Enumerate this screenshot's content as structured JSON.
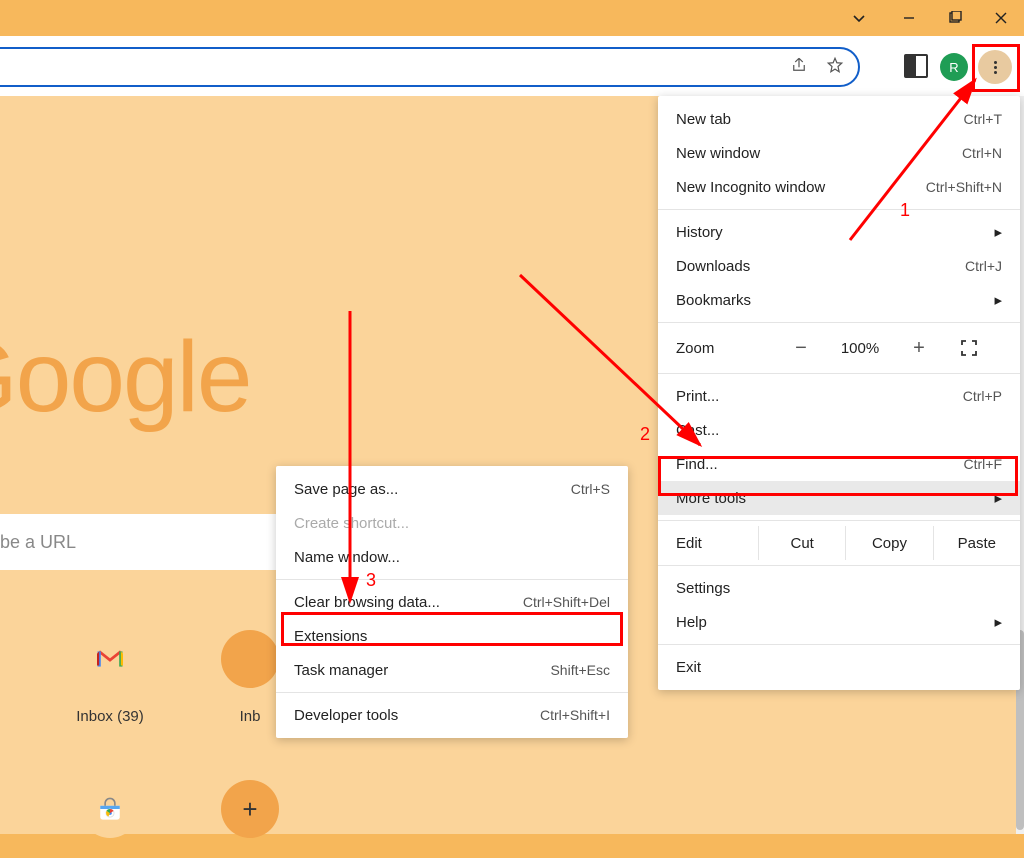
{
  "profile_initial": "R",
  "omnibox_placeholder": "be a URL",
  "google_logo": "Google",
  "shortcuts": [
    {
      "label": ""
    },
    {
      "label": "Inbox (39)"
    },
    {
      "label": "Inb"
    }
  ],
  "main_menu": {
    "new_tab": {
      "label": "New tab",
      "shortcut": "Ctrl+T"
    },
    "new_window": {
      "label": "New window",
      "shortcut": "Ctrl+N"
    },
    "new_incognito": {
      "label": "New Incognito window",
      "shortcut": "Ctrl+Shift+N"
    },
    "history": {
      "label": "History"
    },
    "downloads": {
      "label": "Downloads",
      "shortcut": "Ctrl+J"
    },
    "bookmarks": {
      "label": "Bookmarks"
    },
    "zoom": {
      "label": "Zoom",
      "minus": "−",
      "pct": "100%",
      "plus": "+"
    },
    "print": {
      "label": "Print...",
      "shortcut": "Ctrl+P"
    },
    "cast": {
      "label": "Cast..."
    },
    "find": {
      "label": "Find...",
      "shortcut": "Ctrl+F"
    },
    "more_tools": {
      "label": "More tools"
    },
    "edit": {
      "label": "Edit",
      "cut": "Cut",
      "copy": "Copy",
      "paste": "Paste"
    },
    "settings": {
      "label": "Settings"
    },
    "help": {
      "label": "Help"
    },
    "exit": {
      "label": "Exit"
    }
  },
  "sub_menu": {
    "save_page": {
      "label": "Save page as...",
      "shortcut": "Ctrl+S"
    },
    "create_shortcut": {
      "label": "Create shortcut..."
    },
    "name_window": {
      "label": "Name window..."
    },
    "clear_browsing": {
      "label": "Clear browsing data...",
      "shortcut": "Ctrl+Shift+Del"
    },
    "extensions": {
      "label": "Extensions"
    },
    "task_manager": {
      "label": "Task manager",
      "shortcut": "Shift+Esc"
    },
    "dev_tools": {
      "label": "Developer tools",
      "shortcut": "Ctrl+Shift+I"
    }
  },
  "annotations": {
    "a1": "1",
    "a2": "2",
    "a3": "3"
  }
}
